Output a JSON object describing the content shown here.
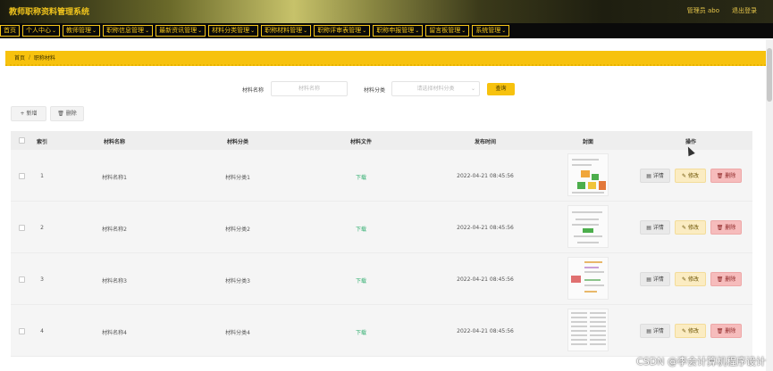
{
  "header": {
    "title": "教师职称资料管理系统",
    "user": "管理员 abo",
    "exit": "退出登录"
  },
  "nav": [
    {
      "label": "首页",
      "caret": false
    },
    {
      "label": "个人中心",
      "caret": true
    },
    {
      "label": "教师管理",
      "caret": true
    },
    {
      "label": "职称信息管理",
      "caret": true
    },
    {
      "label": "最新资讯管理",
      "caret": true
    },
    {
      "label": "材料分类管理",
      "caret": true
    },
    {
      "label": "职称材料管理",
      "caret": true
    },
    {
      "label": "职称评审表管理",
      "caret": true
    },
    {
      "label": "职称申报管理",
      "caret": true
    },
    {
      "label": "留言板管理",
      "caret": true
    },
    {
      "label": "系统管理",
      "caret": true
    }
  ],
  "breadcrumb": {
    "home": "首页",
    "sep": "/",
    "current": "职称材料"
  },
  "search": {
    "name_label": "材料名称",
    "name_placeholder": "材料名称",
    "category_label": "材料分类",
    "category_placeholder": "请选择材料分类",
    "query_button": "查询"
  },
  "toolbar": {
    "add": "+ 新增",
    "delete": "🗑 删除"
  },
  "table": {
    "headers": [
      "索引",
      "材料名称",
      "材料分类",
      "材料文件",
      "发布时间",
      "封面",
      "操作"
    ],
    "rows": [
      {
        "index": "1",
        "name": "材料名称1",
        "category": "材料分类1",
        "file": "下载",
        "time": "2022-04-21 08:45:56"
      },
      {
        "index": "2",
        "name": "材料名称2",
        "category": "材料分类2",
        "file": "下载",
        "time": "2022-04-21 08:45:56"
      },
      {
        "index": "3",
        "name": "材料名称3",
        "category": "材料分类3",
        "file": "下载",
        "time": "2022-04-21 08:45:56"
      },
      {
        "index": "4",
        "name": "材料名称4",
        "category": "材料分类4",
        "file": "下载",
        "time": "2022-04-21 08:45:56"
      }
    ],
    "actions": {
      "detail": "▤ 详情",
      "edit": "✎ 修改",
      "delete": "🗑 删除"
    }
  },
  "watermark": "CSDN @李会计算机程序设计",
  "colors": {
    "accent": "#f7c20e",
    "nav_bg": "#0a0a0a",
    "nav_text": "#f5c518",
    "download": "#2fae6e"
  }
}
